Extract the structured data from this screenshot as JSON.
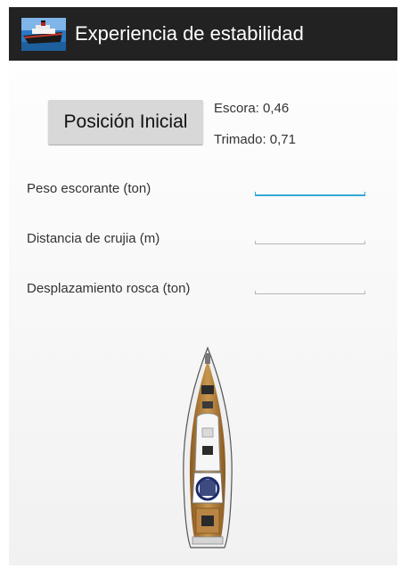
{
  "app": {
    "title": "Experiencia de estabilidad",
    "icon": "ship-icon"
  },
  "controls": {
    "reset_button_label": "Posición Inicial"
  },
  "readouts": {
    "escora": "Escora: 0,46",
    "trimado": "Trimado: 0,71"
  },
  "fields": [
    {
      "label": "Peso escorante (ton)",
      "value": "",
      "focused": true
    },
    {
      "label": "Distancia de crujia (m)",
      "value": "",
      "focused": false
    },
    {
      "label": "Desplazamiento rosca (ton)",
      "value": "",
      "focused": false
    }
  ],
  "image": {
    "icon": "sailboat-top-view"
  },
  "colors": {
    "action_bar": "#222222",
    "focus_accent": "#33a8d8",
    "button_bg": "#d8d8d8"
  }
}
